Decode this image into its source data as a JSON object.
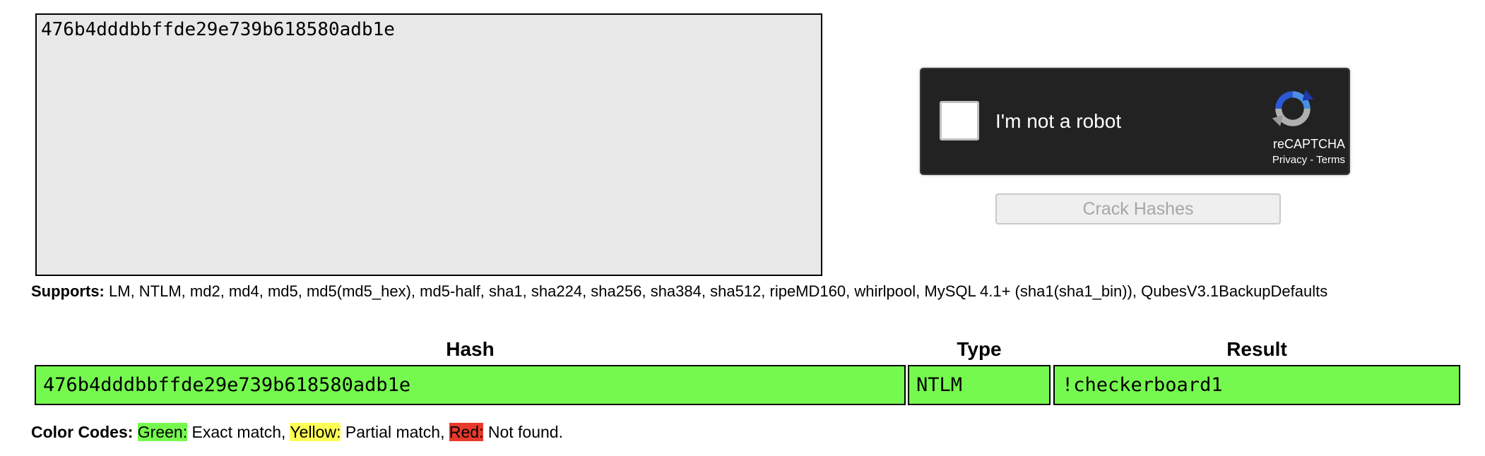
{
  "input": {
    "value": "476b4dddbbffde29e739b618580adb1e"
  },
  "captcha": {
    "label": "I'm not a robot",
    "brand": "reCAPTCHA",
    "privacy": "Privacy",
    "separator": " - ",
    "terms": "Terms",
    "logo_icon": "recaptcha-logo-icon",
    "background": "#222222"
  },
  "crack_button": {
    "label": "Crack Hashes"
  },
  "supports": {
    "label": "Supports:",
    "text": " LM, NTLM, md2, md4, md5, md5(md5_hex), md5-half, sha1, sha224, sha256, sha384, sha512, ripeMD160, whirlpool, MySQL 4.1+ (sha1(sha1_bin)), QubesV3.1BackupDefaults"
  },
  "results": {
    "headers": {
      "hash": "Hash",
      "type": "Type",
      "result": "Result"
    },
    "rows": [
      {
        "hash": "476b4dddbbffde29e739b618580adb1e",
        "type": "NTLM",
        "result": "!checkerboard1",
        "status": "Exact match",
        "color": "#76f94f"
      }
    ]
  },
  "color_codes": {
    "label": "Color Codes:",
    "green_label": "Green:",
    "green_text": " Exact match, ",
    "yellow_label": "Yellow:",
    "yellow_text": " Partial match, ",
    "red_label": "Red:",
    "red_text": " Not found.",
    "colors": {
      "green": "#76f94f",
      "yellow": "#ffff55",
      "red": "#e83a2c"
    }
  }
}
